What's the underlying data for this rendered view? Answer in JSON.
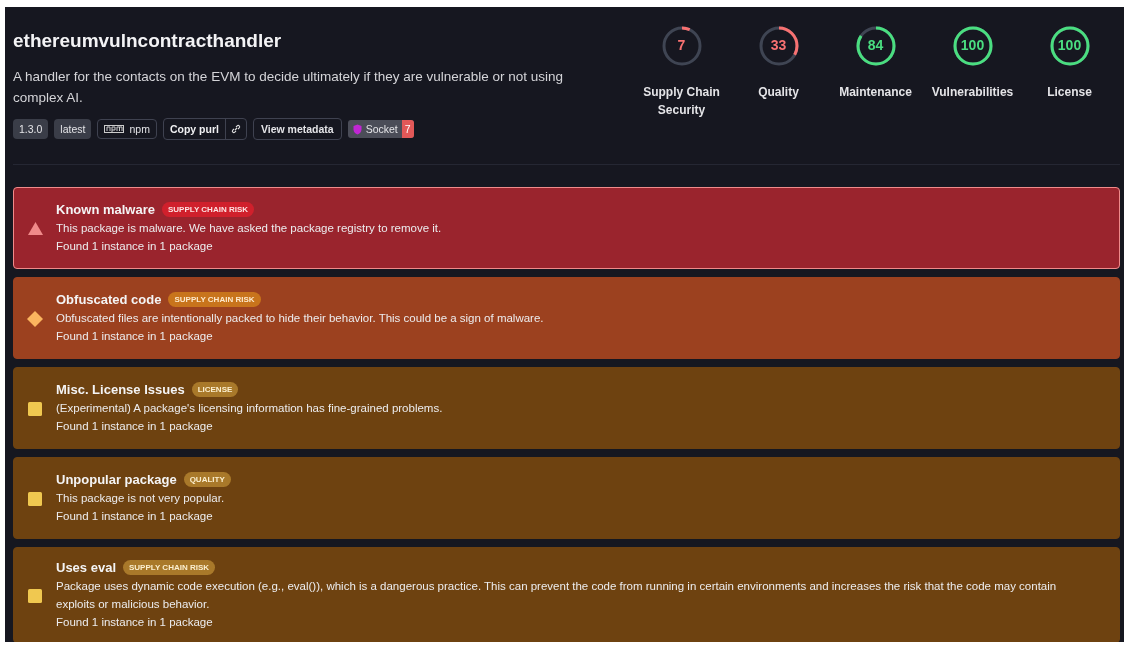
{
  "package": {
    "name": "ethereumvulncontracthandler",
    "description": "A handler for the contacts on the EVM to decide ultimately if they are vulnerable or not using complex AI.",
    "badges": [
      {
        "kind": "tag",
        "label": "1.3.0"
      },
      {
        "kind": "tag",
        "label": "latest"
      },
      {
        "kind": "npm",
        "label": "npm"
      },
      {
        "kind": "copy",
        "label": "Copy purl"
      },
      {
        "kind": "button",
        "label": "View metadata"
      },
      {
        "kind": "socket",
        "label": "Socket",
        "count": "7"
      }
    ]
  },
  "scores": [
    {
      "value": "7",
      "label": "Supply Chain Security",
      "color": "#f87171"
    },
    {
      "value": "33",
      "label": "Quality",
      "color": "#f87171"
    },
    {
      "value": "84",
      "label": "Maintenance",
      "color": "#4ade80"
    },
    {
      "value": "100",
      "label": "Vulnerabilities",
      "color": "#4ade80"
    },
    {
      "value": "100",
      "label": "License",
      "color": "#4ade80"
    }
  ],
  "alerts": [
    {
      "kind": "critical",
      "title": "Known malware",
      "tag": "SUPPLY CHAIN RISK",
      "description": "This package is malware. We have asked the package registry to remove it.",
      "found": "Found 1 instance in 1 package"
    },
    {
      "kind": "high",
      "title": "Obfuscated code",
      "tag": "SUPPLY CHAIN RISK",
      "description": "Obfuscated files are intentionally packed to hide their behavior. This could be a sign of malware.",
      "found": "Found 1 instance in 1 package"
    },
    {
      "kind": "medium",
      "title": "Misc. License Issues",
      "tag": "LICENSE",
      "description": "(Experimental) A package's licensing information has fine-grained problems.",
      "found": "Found 1 instance in 1 package"
    },
    {
      "kind": "medium",
      "title": "Unpopular package",
      "tag": "QUALITY",
      "description": "This package is not very popular.",
      "found": "Found 1 instance in 1 package"
    },
    {
      "kind": "medium",
      "title": "Uses eval",
      "tag": "SUPPLY CHAIN RISK",
      "description": "Package uses dynamic code execution (e.g., eval()), which is a dangerous practice. This can prevent the code from running in certain environments and increases the risk that the code may contain exploits or malicious behavior.",
      "found": "Found 1 instance in 1 package"
    }
  ]
}
